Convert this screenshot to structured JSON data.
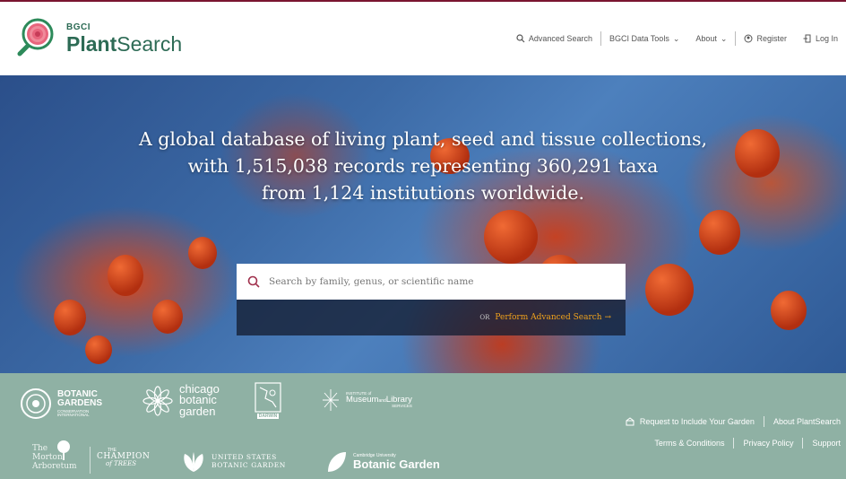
{
  "header": {
    "brand_small": "BGCI",
    "brand_bold": "Plant",
    "brand_rest": "Search",
    "nav": {
      "advanced_search": "Advanced Search",
      "data_tools": "BGCI Data Tools",
      "about": "About",
      "register": "Register",
      "login": "Log In"
    }
  },
  "hero": {
    "line1": "A global database of living plant, seed and tissue collections,",
    "line2": "with 1,515,038 records representing 360,291 taxa",
    "line3": "from 1,124 institutions worldwide.",
    "search_placeholder": "Search by family, genus, or scientific name",
    "or_label": "OR",
    "advanced_link": "Perform Advanced Search →"
  },
  "footer": {
    "logos": {
      "bgci_line1": "BOTANIC",
      "bgci_line2": "GARDENS",
      "bgci_line3": "CONSERVATION",
      "bgci_line4": "INTERNATIONAL",
      "chicago_line1": "chicago",
      "chicago_line2": "botanic",
      "chicago_line3": "garden",
      "darwin": "DARWIN",
      "imls_small": "INSTITUTE of",
      "imls_main": "Museum",
      "imls_and": "and",
      "imls_library": "Library",
      "imls_services": "SERVICES",
      "morton_the": "The",
      "morton_name": "Morton",
      "morton_arb": "Arboretum",
      "champion_the": "THE",
      "champion_main": "CHAMPION",
      "champion_of": "of TREES",
      "usbg_line1": "UNITED STATES",
      "usbg_line2": "BOTANIC GARDEN",
      "cambridge_small": "Cambridge University",
      "cambridge_main": "Botanic Garden"
    },
    "links": {
      "request": "Request to Include Your Garden",
      "about": "About PlantSearch",
      "terms": "Terms & Conditions",
      "privacy": "Privacy Policy",
      "support": "Support"
    }
  },
  "colors": {
    "brand_green": "#2d6b55",
    "accent_maroon": "#7a1430",
    "footer_bg": "#8fb1a4",
    "advanced_link": "#f0a21c"
  }
}
